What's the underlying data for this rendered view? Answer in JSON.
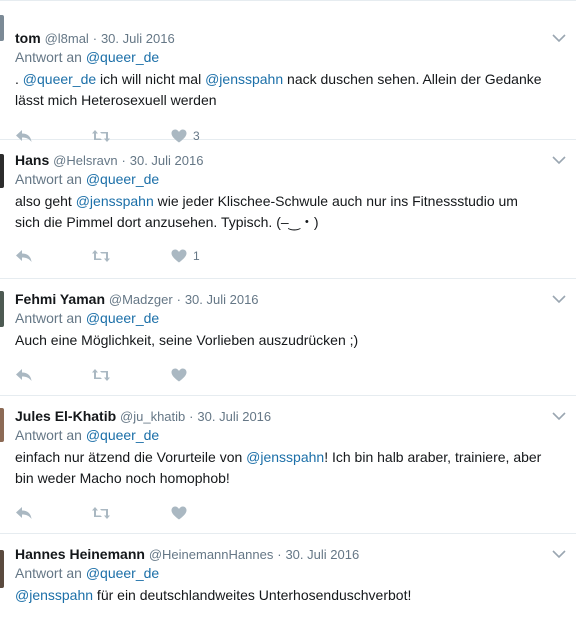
{
  "reply_prefix": "Antwort an",
  "tweets": [
    {
      "fullname": "tom",
      "username": "@l8mal",
      "sep": "·",
      "date": "30. Juli 2016",
      "reply_to": "@queer_de",
      "text_parts": [
        ". ",
        "@queer_de",
        " ich will nicht mal ",
        "@jensspahn",
        " nack duschen sehen. Allein der Gedanke lässt mich Heterosexuell werden"
      ],
      "like_count": "3"
    },
    {
      "fullname": "Hans",
      "username": "@Helsravn",
      "sep": "·",
      "date": "30. Juli 2016",
      "reply_to": "@queer_de",
      "text_parts": [
        "also geht ",
        "@jensspahn",
        " wie jeder Klischee-Schwule auch nur ins Fitnessstudio um sich die Pimmel dort anzusehen. Typisch. (–‿・)"
      ],
      "like_count": "1"
    },
    {
      "fullname": "Fehmi Yaman",
      "username": "@Madzger",
      "sep": "·",
      "date": "30. Juli 2016",
      "reply_to": "@queer_de",
      "text_parts": [
        "Auch eine Möglichkeit, seine Vorlieben auszudrücken ;)"
      ],
      "like_count": ""
    },
    {
      "fullname": "Jules El-Khatib",
      "username": "@ju_khatib",
      "sep": "·",
      "date": "30. Juli 2016",
      "reply_to": "@queer_de",
      "text_parts": [
        "einfach nur ätzend die Vorurteile von ",
        "@jensspahn",
        "! Ich bin halb araber, trainiere, aber bin weder Macho noch homophob!"
      ],
      "like_count": ""
    },
    {
      "fullname": "Hannes Heinemann",
      "username": "@HeinemannHannes",
      "sep": "·",
      "date": "30. Juli 2016",
      "reply_to": "@queer_de",
      "text_parts": [
        "@jensspahn",
        " für ein deutschlandweites  Unterhosenduschverbot!"
      ],
      "like_count": ""
    }
  ],
  "icons": {
    "reply": "reply-icon",
    "retweet": "retweet-icon",
    "like": "heart-icon",
    "more": "chevron-down-icon"
  },
  "colors": {
    "mention": "#1b6fa8",
    "meta": "#657786",
    "icon": "#aab8c2",
    "border": "#e6ecf0"
  }
}
